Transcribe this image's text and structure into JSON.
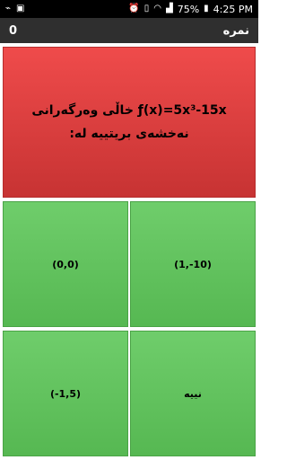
{
  "status_bar": {
    "battery_percent": "75%",
    "time": "4:25 PM",
    "icons": [
      "usb-icon",
      "app-notification-icon",
      "alarm-icon",
      "vibrate-icon",
      "wifi-icon",
      "signal-icon",
      "battery-icon"
    ]
  },
  "app_bar": {
    "score_label": "نمره",
    "score_value": "0"
  },
  "question": {
    "text": "ƒ(x)=5x³-15x خاڵی وەرگەرانی نەخشەی بریتییە لە:"
  },
  "answers": [
    {
      "label": "(0,0)"
    },
    {
      "label": "(1,-10)"
    },
    {
      "label": "(-1,5)"
    },
    {
      "label": "نییە"
    }
  ],
  "colors": {
    "question_bg": "#e04242",
    "answer_bg": "#63c35f",
    "app_bar_bg": "#2f2f2f"
  }
}
